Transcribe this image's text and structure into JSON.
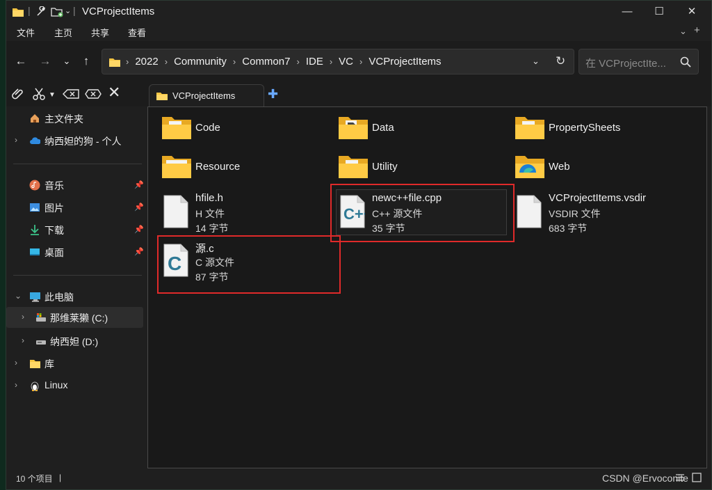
{
  "window": {
    "title": "VCProjectItems"
  },
  "menu": {
    "items": [
      "文件",
      "主页",
      "共享",
      "查看"
    ]
  },
  "nav": {
    "breadcrumbs": [
      "2022",
      "Community",
      "Common7",
      "IDE",
      "VC",
      "VCProjectItems"
    ],
    "search_placeholder": "在 VCProjectIte..."
  },
  "tabs": [
    {
      "label": "VCProjectItems"
    }
  ],
  "sidebar": {
    "items": [
      {
        "label": "主文件夹",
        "icon": "home-icon"
      },
      {
        "label": "纳西妲的狗 - 个人",
        "icon": "onedrive-icon"
      },
      {
        "label": "音乐",
        "icon": "music-icon"
      },
      {
        "label": "图片",
        "icon": "pictures-icon"
      },
      {
        "label": "下载",
        "icon": "download-icon"
      },
      {
        "label": "桌面",
        "icon": "desktop-icon"
      },
      {
        "label": "此电脑",
        "icon": "pc-icon"
      },
      {
        "label": "那维莱獭 (C:)",
        "icon": "drive-c-icon"
      },
      {
        "label": "纳西妲 (D:)",
        "icon": "drive-d-icon"
      },
      {
        "label": "库",
        "icon": "library-icon"
      },
      {
        "label": "Linux",
        "icon": "linux-icon"
      }
    ]
  },
  "folders": [
    {
      "name": "Code"
    },
    {
      "name": "Data"
    },
    {
      "name": "PropertySheets"
    },
    {
      "name": "Resource"
    },
    {
      "name": "Utility"
    },
    {
      "name": "Web"
    }
  ],
  "files": [
    {
      "name": "hfile.h",
      "type": "H 文件",
      "size": "14 字节",
      "icon": "h-file-icon"
    },
    {
      "name": "newc++file.cpp",
      "type": "C++ 源文件",
      "size": "35 字节",
      "icon": "cpp-file-icon",
      "badge": "C++"
    },
    {
      "name": "VCProjectItems.vsdir",
      "type": "VSDIR 文件",
      "size": "683 字节",
      "icon": "vsdir-file-icon"
    },
    {
      "name": "源.c",
      "type": "C 源文件",
      "size": "87 字节",
      "icon": "c-file-icon",
      "badge": "C"
    }
  ],
  "status": {
    "item_count": "10 个项目"
  },
  "watermark": "CSDN @Ervoconite",
  "colors": {
    "accent_red": "#e02a2a",
    "folder_yellow": "#f5c542",
    "link_blue": "#6aa9ff"
  }
}
